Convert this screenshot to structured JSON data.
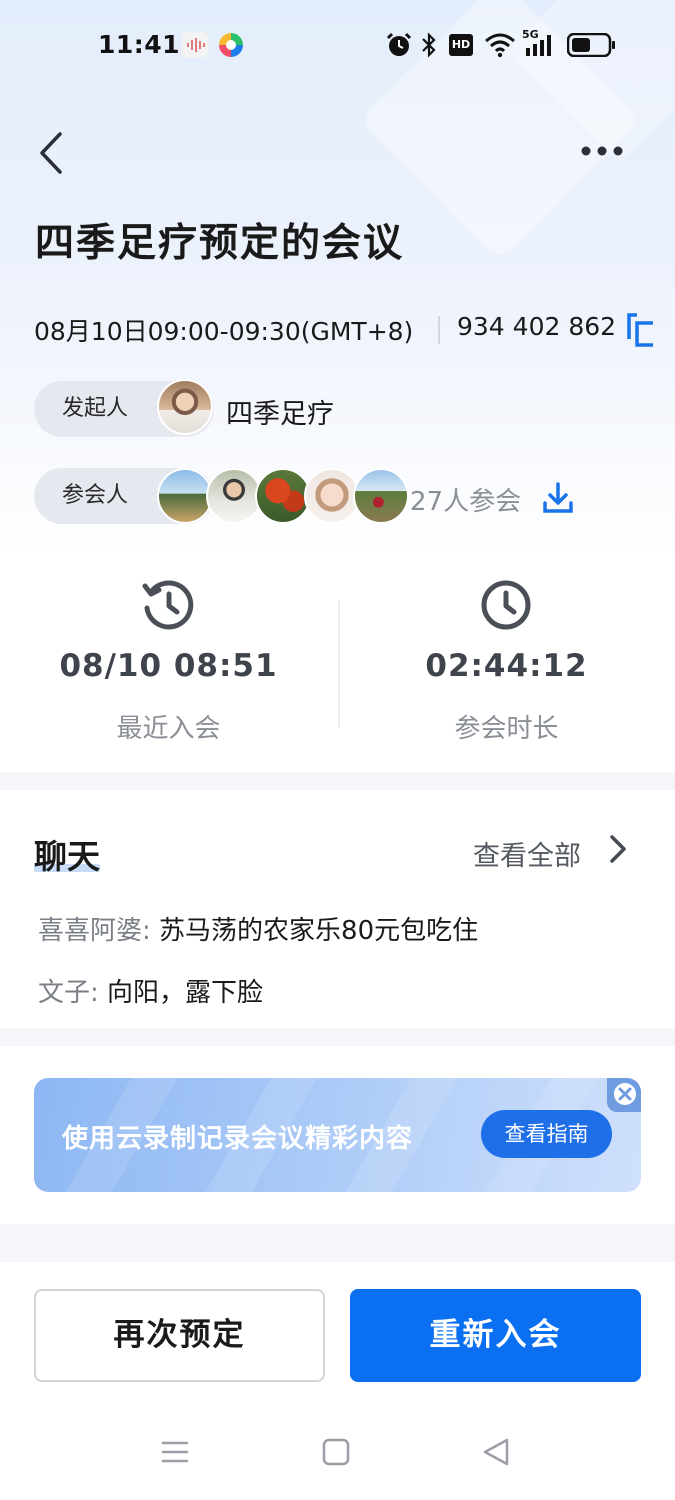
{
  "status_bar": {
    "time": "11:41",
    "hd_label": "HD",
    "network_label": "5G"
  },
  "header": {
    "title": "四季足疗预定的会议"
  },
  "meeting": {
    "time_range": "08月10日09:00-09:30(GMT+8)",
    "meeting_id": "934 402 862",
    "host_label": "发起人",
    "host_name": "四季足疗",
    "attendees_label": "参会人",
    "attendee_count": "27人参会"
  },
  "stats": {
    "last_join_value": "08/10 08:51",
    "last_join_label": "最近入会",
    "duration_value": "02:44:12",
    "duration_label": "参会时长"
  },
  "chat": {
    "title": "聊天",
    "view_all": "查看全部",
    "messages": [
      {
        "sender": "喜喜阿婆: ",
        "text": "苏马荡的农家乐80元包吃住"
      },
      {
        "sender": "文子: ",
        "text": "向阳，露下脸"
      }
    ]
  },
  "banner": {
    "text": "使用云录制记录会议精彩内容",
    "button": "查看指南"
  },
  "actions": {
    "reschedule": "再次预定",
    "rejoin": "重新入会"
  },
  "colors": {
    "accent": "#0a6ff0",
    "banner_button": "#1e6fe8",
    "muted_text": "#8a8e96"
  }
}
